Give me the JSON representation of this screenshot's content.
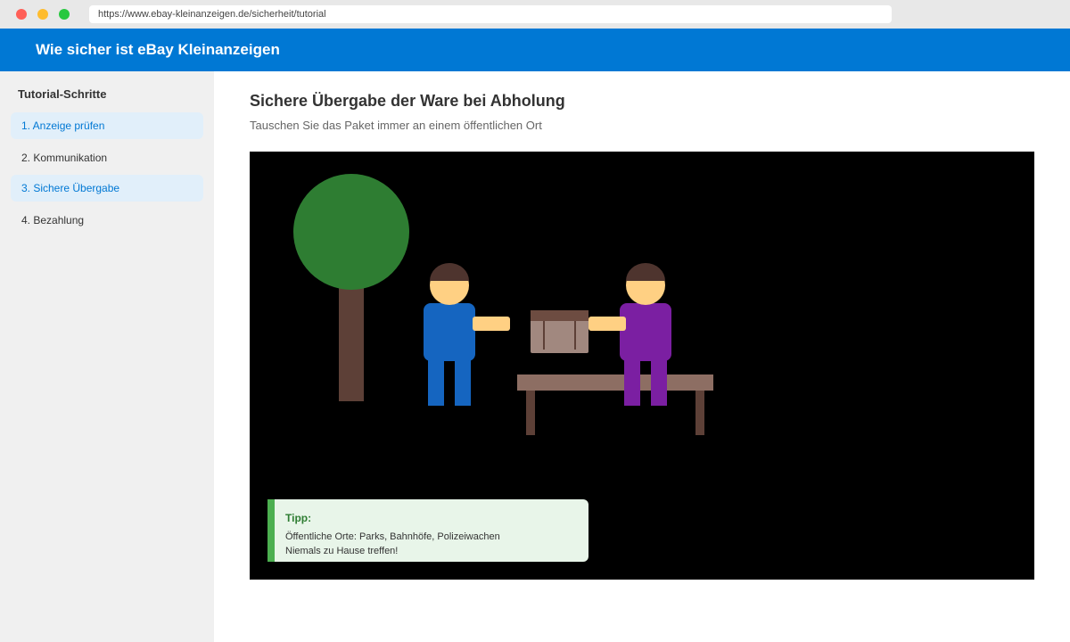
{
  "browser": {
    "url": "https://www.ebay-kleinanzeigen.de/sicherheit/tutorial"
  },
  "header": {
    "title": "Wie sicher ist eBay Kleinanzeigen"
  },
  "sidebar": {
    "heading": "Tutorial-Schritte",
    "items": [
      {
        "label": "1. Anzeige prüfen",
        "active": true
      },
      {
        "label": "2. Kommunikation",
        "active": false
      },
      {
        "label": "3. Sichere Übergabe",
        "active": true
      },
      {
        "label": "4. Bezahlung",
        "active": false
      }
    ]
  },
  "main": {
    "title": "Sichere Übergabe der Ware bei Abholung",
    "subtitle": "Tauschen Sie das Paket immer an einem öffentlichen Ort"
  },
  "tip": {
    "title": "Tipp:",
    "lines": [
      "Öffentliche Orte: Parks, Bahnhöfe, Polizeiwachen",
      "Niemals zu Hause treffen!"
    ]
  },
  "colors": {
    "brand": "#0078d4",
    "tree_crown": "#2e7d32",
    "tree_trunk": "#5d4037",
    "person_left_shirt": "#1565c0",
    "person_right_shirt": "#7b1fa2",
    "skin": "#ffd083",
    "hair": "#4e342e",
    "bench": "#8d6e63",
    "package": "#a1887f"
  },
  "icons": {
    "window_controls": [
      "close-dot",
      "minimize-dot",
      "maximize-dot"
    ]
  }
}
